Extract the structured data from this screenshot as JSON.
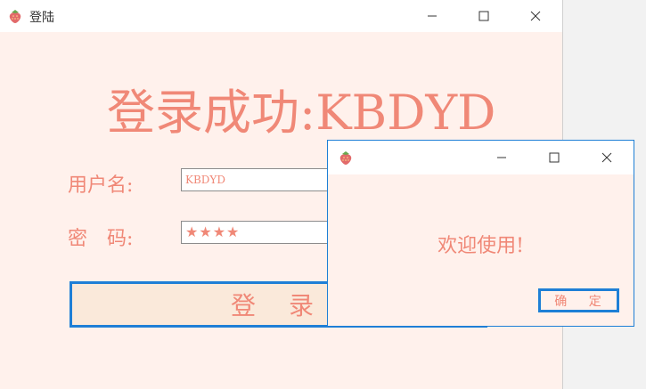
{
  "main_window": {
    "title": "登陆",
    "heading": "登录成功:KBDYD",
    "username_label": "用户名:",
    "username_value": "KBDYD",
    "password_label": "密　码:",
    "password_display": "★★★★",
    "login_button_label": "登 录"
  },
  "dialog": {
    "title": "",
    "message": "欢迎使用!",
    "ok_button_label": "确 定"
  },
  "colors": {
    "window_bg": "#fff1ec",
    "accent_text": "#f08877",
    "button_border": "#1e7fd6",
    "login_button_bg": "#fae9da"
  },
  "icons": {
    "app_icon": "strawberry-icon",
    "minimize": "minimize-icon",
    "maximize": "maximize-icon",
    "close": "close-icon"
  }
}
